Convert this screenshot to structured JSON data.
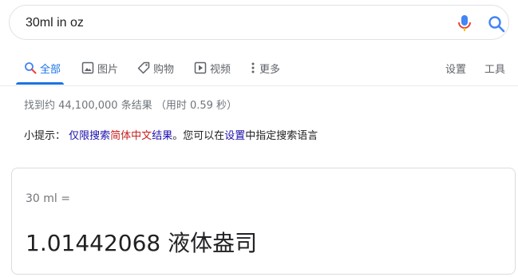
{
  "search": {
    "query": "30ml in oz",
    "mic_icon": "mic-icon",
    "search_icon": "search-icon"
  },
  "tabs": [
    {
      "label": "全部",
      "icon": "search-icon",
      "active": true
    },
    {
      "label": "图片",
      "icon": "image-icon"
    },
    {
      "label": "购物",
      "icon": "tag-icon"
    },
    {
      "label": "视频",
      "icon": "play-icon"
    },
    {
      "label": "更多",
      "icon": "more-vert-icon"
    }
  ],
  "tools": {
    "settings": "设置",
    "tools": "工具"
  },
  "result_stats": "找到约 44,100,000 条结果 （用时 0.59 秒）",
  "hint": {
    "prefix": "小提示：",
    "link_1": "仅限搜索",
    "link_2": "简体中文",
    "link_3": "结果",
    "middle": "。您可以在",
    "settings_link": "设置",
    "suffix": "中指定搜索语言"
  },
  "converter": {
    "input": "30 ml =",
    "result": "1.01442068 液体盎司"
  },
  "colors": {
    "accent": "#1a73e8",
    "link": "#1a0dab",
    "link_red": "#c5221f",
    "muted": "#70757a"
  }
}
